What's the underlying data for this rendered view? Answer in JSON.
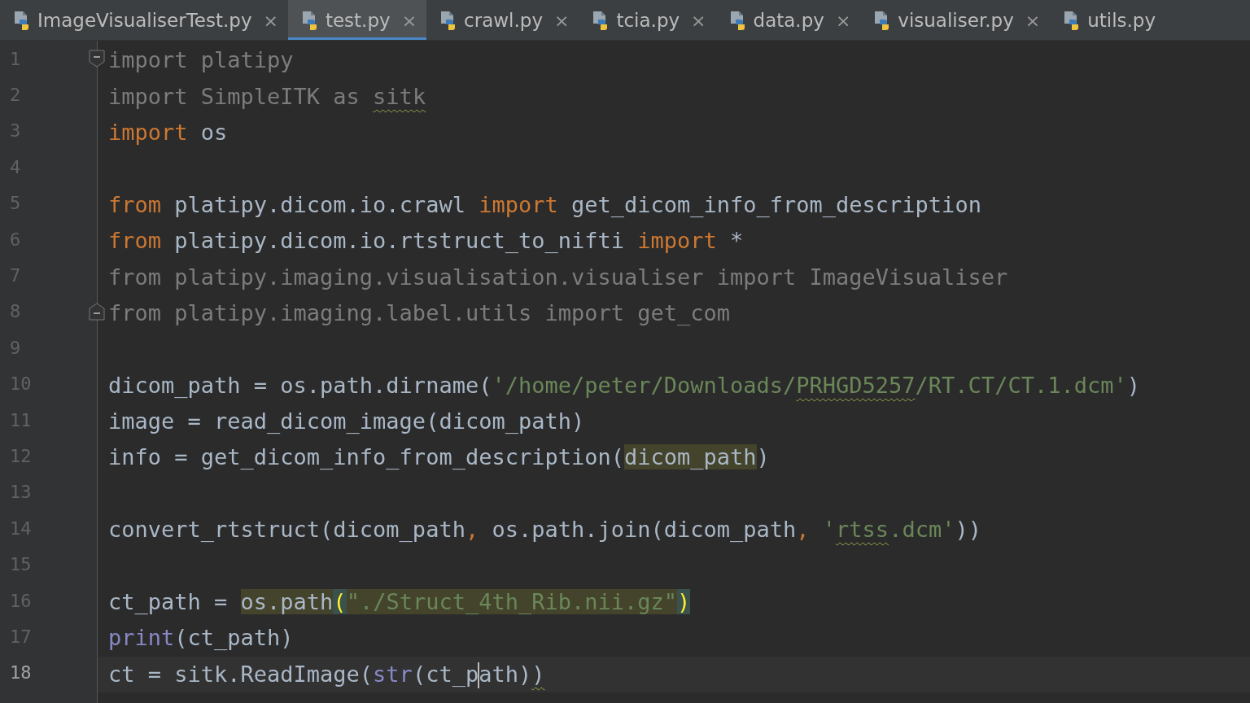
{
  "tabs": [
    {
      "label": "ImageVisualiserTest.py",
      "selected": false,
      "close": "×"
    },
    {
      "label": "test.py",
      "selected": true,
      "close": "×"
    },
    {
      "label": "crawl.py",
      "selected": false,
      "close": "×"
    },
    {
      "label": "tcia.py",
      "selected": false,
      "close": "×"
    },
    {
      "label": "data.py",
      "selected": false,
      "close": "×"
    },
    {
      "label": "visualiser.py",
      "selected": false,
      "close": "×"
    },
    {
      "label": "utils.py",
      "selected": false
    }
  ],
  "editor": {
    "lines": [
      {
        "number": "1",
        "current": false,
        "fold_start": true,
        "tokens": [
          {
            "kind": "dim",
            "text": "import platipy"
          }
        ]
      },
      {
        "number": "2",
        "current": false,
        "tokens": [
          {
            "kind": "dim",
            "text": "import SimpleITK as "
          },
          {
            "kind": "dim",
            "text": "sitk",
            "typo": true
          }
        ]
      },
      {
        "number": "3",
        "current": false,
        "tokens": [
          {
            "kind": "kw",
            "text": "import"
          },
          {
            "kind": "id",
            "text": " os"
          }
        ]
      },
      {
        "number": "4",
        "current": false
      },
      {
        "number": "5",
        "current": false,
        "tokens": [
          {
            "kind": "kw",
            "text": "from"
          },
          {
            "kind": "id",
            "text": " platipy.dicom.io.crawl "
          },
          {
            "kind": "kw",
            "text": "import"
          },
          {
            "kind": "id",
            "text": " get_dicom_info_from_description"
          }
        ]
      },
      {
        "number": "6",
        "current": false,
        "tokens": [
          {
            "kind": "kw",
            "text": "from"
          },
          {
            "kind": "id",
            "text": " platipy.dicom.io.rtstruct_to_nifti "
          },
          {
            "kind": "kw",
            "text": "import"
          },
          {
            "kind": "id",
            "text": " *"
          }
        ]
      },
      {
        "number": "7",
        "current": false,
        "tokens": [
          {
            "kind": "dim",
            "text": "from platipy.imaging.visualisation.visualiser import ImageVisualiser"
          }
        ]
      },
      {
        "number": "8",
        "current": false,
        "fold_end": true,
        "tokens": [
          {
            "kind": "dim",
            "text": "from platipy.imaging.label.utils import get_com"
          }
        ]
      },
      {
        "number": "9",
        "current": false
      },
      {
        "number": "10",
        "current": false,
        "tokens": [
          {
            "kind": "id",
            "text": "dicom_path = os.path.dirname("
          },
          {
            "kind": "str",
            "text": "'/home/peter/Downloads/"
          },
          {
            "kind": "str",
            "text": "PRHGD5257",
            "typo": true
          },
          {
            "kind": "str",
            "text": "/RT.CT/CT.1.dcm'"
          },
          {
            "kind": "id",
            "text": ")"
          }
        ]
      },
      {
        "number": "11",
        "current": false,
        "tokens": [
          {
            "kind": "id",
            "text": "image = read_dicom_image(dicom_path)"
          }
        ]
      },
      {
        "number": "12",
        "current": false,
        "tokens": [
          {
            "kind": "id",
            "text": "info = get_dicom_info_from_description("
          },
          {
            "kind": "hl",
            "text": "dicom_path"
          },
          {
            "kind": "id",
            "text": ")"
          }
        ]
      },
      {
        "number": "13",
        "current": false
      },
      {
        "number": "14",
        "current": false,
        "tokens": [
          {
            "kind": "id",
            "text": "convert_rtstruct(dicom_path"
          },
          {
            "kind": "punct",
            "text": ","
          },
          {
            "kind": "id",
            "text": " os.path.join(dicom_path"
          },
          {
            "kind": "punct",
            "text": ", "
          },
          {
            "kind": "str",
            "text": "'"
          },
          {
            "kind": "str",
            "text": "rtss",
            "typo": true
          },
          {
            "kind": "str",
            "text": ".dcm'"
          },
          {
            "kind": "id",
            "text": "))"
          }
        ]
      },
      {
        "number": "15",
        "current": false
      },
      {
        "number": "16",
        "current": false,
        "tokens": [
          {
            "kind": "id",
            "text": "ct_path = "
          },
          {
            "kind": "hl",
            "text": "os.path"
          },
          {
            "kind": "brace",
            "text": "("
          },
          {
            "kind": "hlstr",
            "text": "\"./Struct_4th_Rib.nii.gz\""
          },
          {
            "kind": "brace",
            "text": ")"
          }
        ]
      },
      {
        "number": "17",
        "current": false,
        "tokens": [
          {
            "kind": "builtin",
            "text": "print"
          },
          {
            "kind": "id",
            "text": "(ct_path)"
          }
        ]
      },
      {
        "number": "18",
        "current": true,
        "tokens": [
          {
            "kind": "id",
            "text": "ct = sitk.ReadImage("
          },
          {
            "kind": "builtin",
            "text": "str"
          },
          {
            "kind": "id",
            "text": "(ct_p",
            "caret": true
          },
          {
            "kind": "id",
            "text": "ath)"
          },
          {
            "kind": "id",
            "text": ")",
            "typo": true
          }
        ]
      }
    ]
  }
}
